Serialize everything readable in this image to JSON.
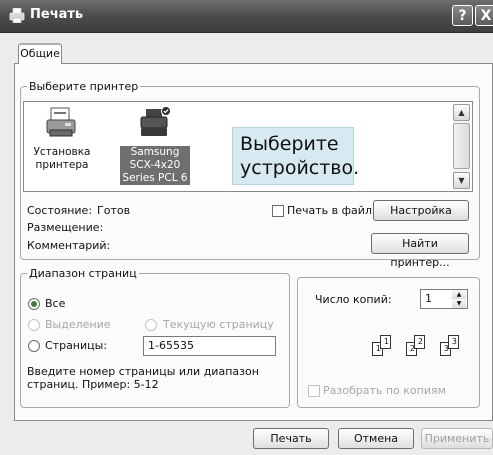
{
  "window": {
    "title": "Печать",
    "help_glyph": "?",
    "close_glyph": "X"
  },
  "tabs": [
    {
      "label": "Общие"
    }
  ],
  "printer_group": {
    "legend": "Выберите принтер",
    "items": [
      {
        "label_lines": [
          "Установка",
          "принтера"
        ],
        "icon": "add-printer-icon"
      },
      {
        "label_lines": [
          "Samsung",
          "SCX-4x20",
          "Series PCL 6"
        ],
        "icon": "printer-icon",
        "selected": true
      }
    ],
    "callout_lines": [
      "Выберите",
      "устройство."
    ]
  },
  "status": {
    "state_label": "Состояние:",
    "state_value": "Готов",
    "location_label": "Размещение:",
    "comment_label": "Комментарий:",
    "print_to_file_label": "Печать в файл",
    "settings_button": "Настройка",
    "find_printer_button": "Найти принтер..."
  },
  "page_range": {
    "legend": "Диапазон страниц",
    "all": "Все",
    "selection": "Выделение",
    "current_page": "Текущую страницу",
    "pages": "Страницы:",
    "pages_value": "1-65535",
    "hint_lines": [
      "Введите номер страницы или диапазон",
      "страниц.  Пример: 5-12"
    ]
  },
  "copies": {
    "label": "Число копий:",
    "value": "1",
    "collate_label": "Разобрать по копиям",
    "page_numbers": [
      "1",
      "1",
      "2",
      "2",
      "3",
      "3"
    ]
  },
  "footer": {
    "print_button": "Печать",
    "cancel_button": "Отмена",
    "apply_button": "Применить"
  }
}
